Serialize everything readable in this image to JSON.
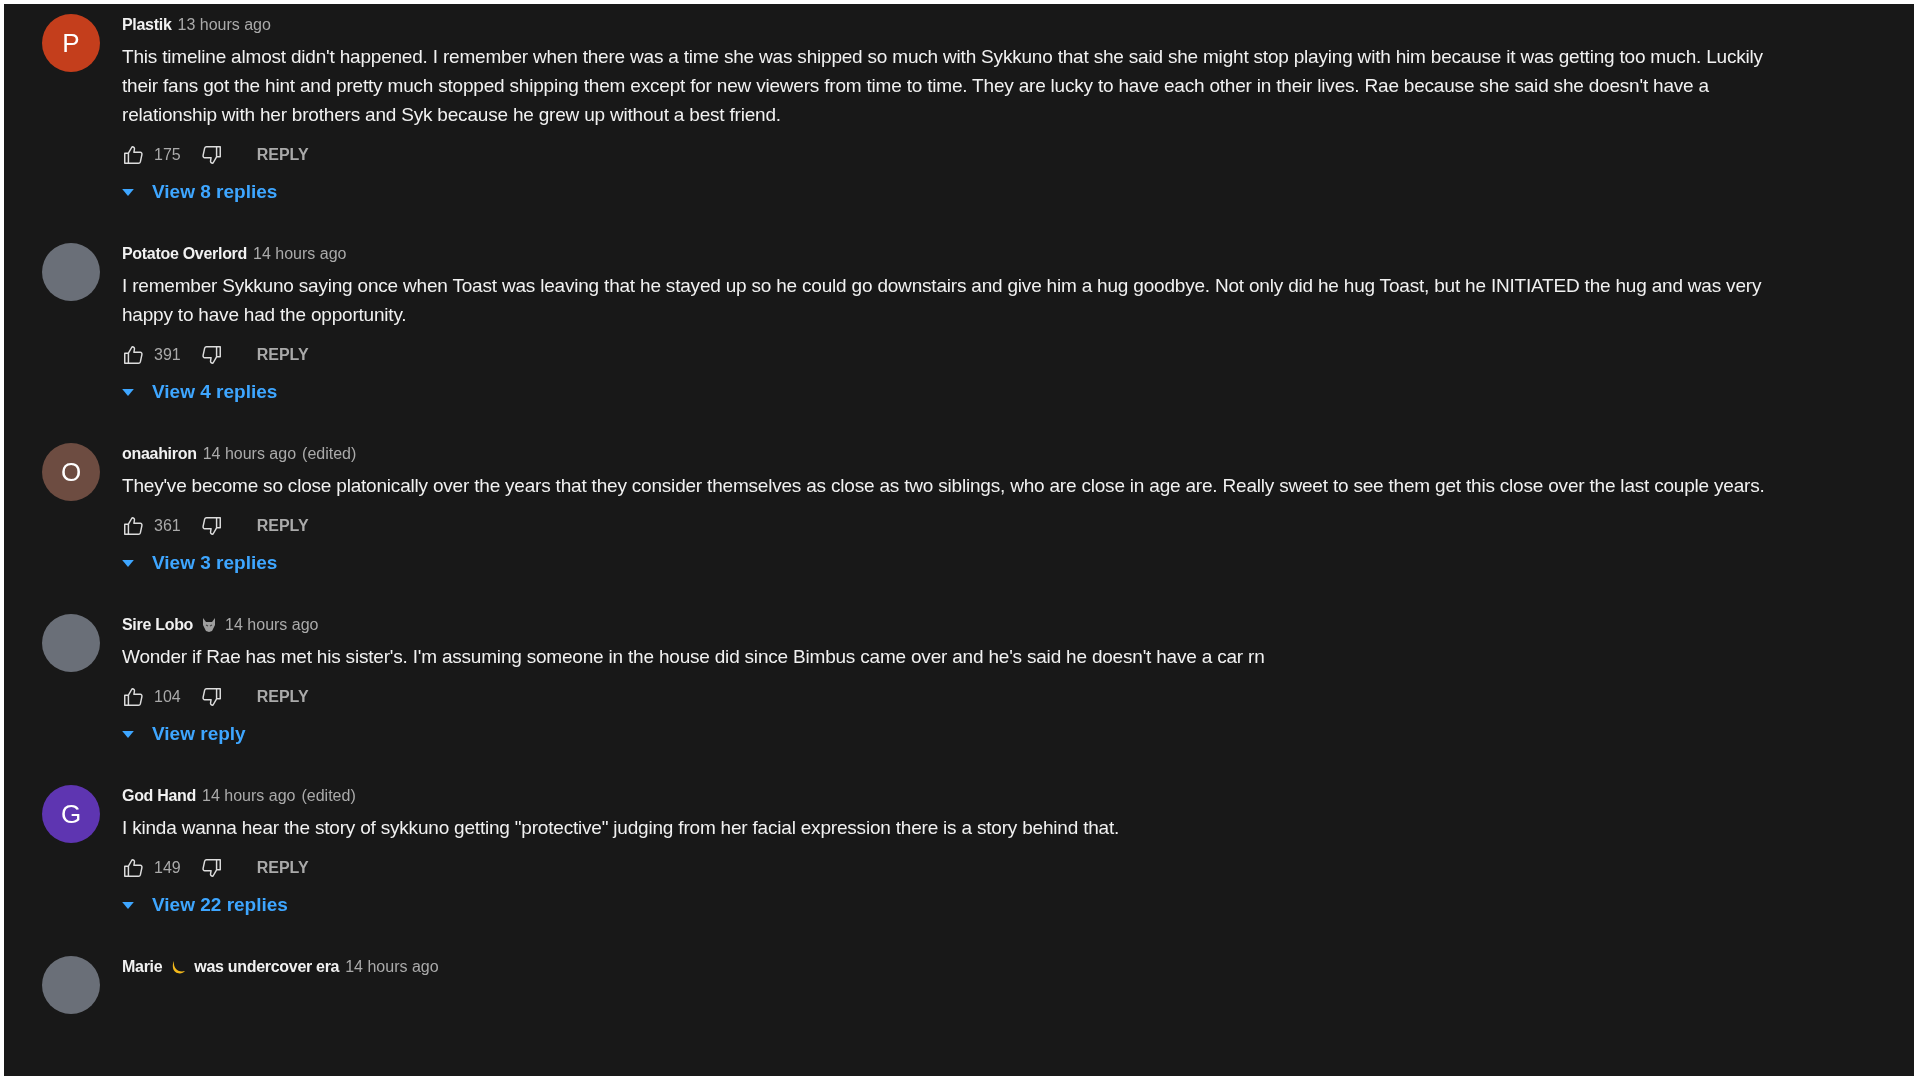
{
  "comments": [
    {
      "author": "Plastik",
      "avatar": {
        "kind": "letter",
        "initial": "P",
        "color": "#c43e1c"
      },
      "time": "13 hours ago",
      "text": "This timeline almost didn't happened. I remember when there was a time she was shipped so much with Sykkuno that she said she might stop playing with him because it was getting too much. Luckily their fans got the hint and pretty much stopped shipping them except for new viewers from time to time. They are lucky to have each other in their lives. Rae because she said she doesn't have a relationship with her brothers and Syk because he grew up without a best friend.",
      "likes": "175",
      "reply_label": "REPLY",
      "replies_label": "View 8 replies"
    },
    {
      "author": "Potatoe Overlord",
      "avatar": {
        "kind": "photo"
      },
      "time": "14 hours ago",
      "text": "I remember Sykkuno saying once when Toast was leaving that he stayed up so he could go downstairs and give him a hug goodbye. Not only did he hug Toast, but he INITIATED the hug and was very happy to have had the opportunity.",
      "likes": "391",
      "reply_label": "REPLY",
      "replies_label": "View 4 replies"
    },
    {
      "author": "onaahiron",
      "avatar": {
        "kind": "letter",
        "initial": "O",
        "color": "#6d4c41"
      },
      "time": "14 hours ago",
      "edited_label": "(edited)",
      "text": "They've become so close platonically over the years that they consider themselves as close as two siblings, who are close in age are. Really sweet to see them get this close over the last couple years.",
      "likes": "361",
      "reply_label": "REPLY",
      "replies_label": "View 3 replies"
    },
    {
      "author": "Sire Lobo",
      "author_badge": {
        "kind": "wolf"
      },
      "avatar": {
        "kind": "photo"
      },
      "time": "14 hours ago",
      "text": "Wonder if Rae has met his sister's. I'm assuming someone in the house did since Bimbus came over and he's said he doesn't have a car rn",
      "likes": "104",
      "reply_label": "REPLY",
      "replies_label": "View reply"
    },
    {
      "author": "God Hand",
      "avatar": {
        "kind": "letter",
        "initial": "G",
        "color": "#5e35b1"
      },
      "time": "14 hours ago",
      "edited_label": "(edited)",
      "text": "I kinda wanna hear the story of sykkuno getting \"protective\" judging from her facial expression there is a story behind that.",
      "likes": "149",
      "reply_label": "REPLY",
      "replies_label": "View 22 replies"
    },
    {
      "author": "Marie",
      "author_badge": {
        "kind": "moon"
      },
      "author_suffix": "was undercover era",
      "avatar": {
        "kind": "photo"
      },
      "time": "14 hours ago"
    }
  ]
}
